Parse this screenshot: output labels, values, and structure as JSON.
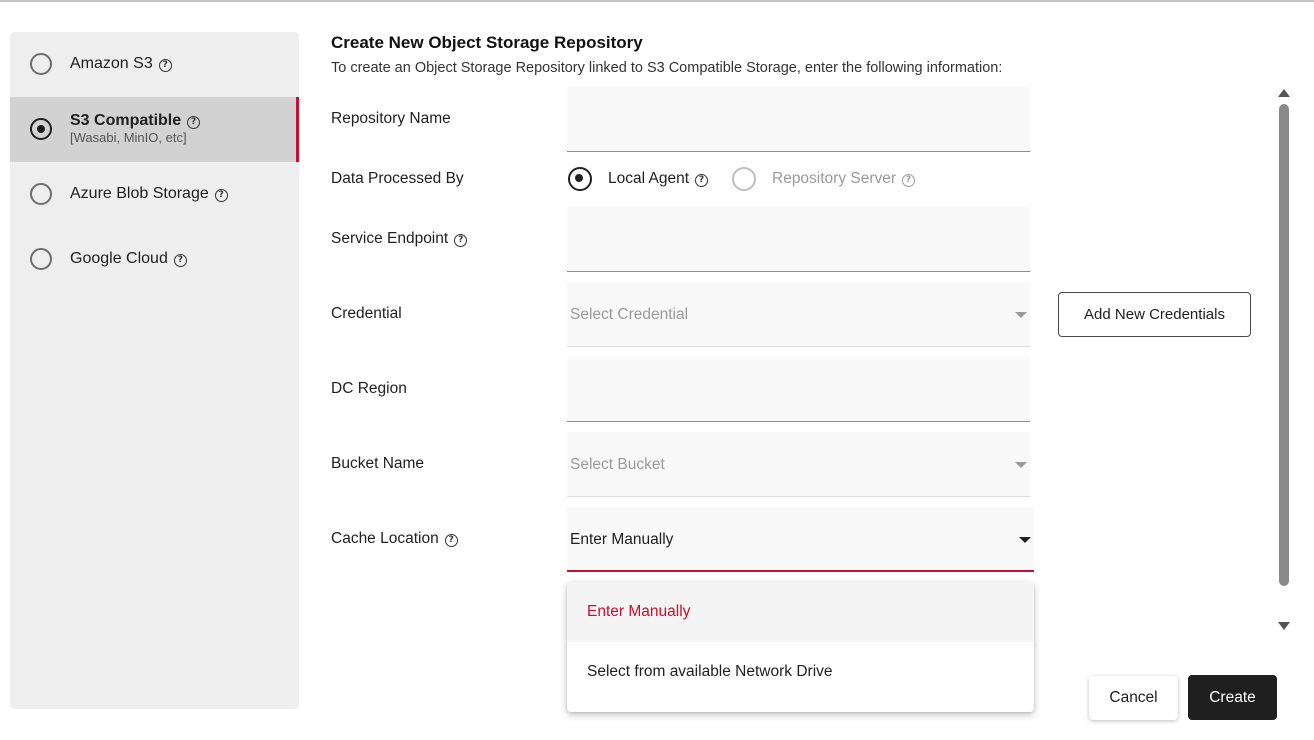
{
  "sidebar": {
    "items": [
      {
        "label": "Amazon S3",
        "selected": false
      },
      {
        "label": "S3 Compatible",
        "sublabel": "[Wasabi, MinIO, etc]",
        "selected": true
      },
      {
        "label": "Azure Blob Storage",
        "selected": false
      },
      {
        "label": "Google Cloud",
        "selected": false
      }
    ]
  },
  "header": {
    "title": "Create New Object Storage Repository",
    "subtitle": "To create an Object Storage Repository linked to S3 Compatible Storage, enter the following information:"
  },
  "form": {
    "repository_name": {
      "label": "Repository Name",
      "value": ""
    },
    "data_processed_by": {
      "label": "Data Processed By",
      "options": [
        {
          "label": "Local Agent",
          "selected": true
        },
        {
          "label": "Repository Server",
          "selected": false,
          "disabled": true
        }
      ]
    },
    "service_endpoint": {
      "label": "Service Endpoint",
      "value": ""
    },
    "credential": {
      "label": "Credential",
      "placeholder": "Select Credential",
      "add_button": "Add New Credentials"
    },
    "dc_region": {
      "label": "DC Region",
      "value": ""
    },
    "bucket_name": {
      "label": "Bucket Name",
      "placeholder": "Select Bucket"
    },
    "cache_location": {
      "label": "Cache Location",
      "value": "Enter Manually",
      "menu": [
        "Enter Manually",
        "Select from available Network Drive"
      ]
    }
  },
  "buttons": {
    "cancel": "Cancel",
    "create": "Create"
  },
  "colors": {
    "accent": "#c8102e",
    "primary_button": "#1f1f1f",
    "sidebar_bg": "#eeeeee",
    "sidebar_selected": "#d2d2d2"
  },
  "icons": [
    "help-circle-icon",
    "radio-icon",
    "chevron-down-icon",
    "scroll-up-icon",
    "scroll-down-icon"
  ]
}
